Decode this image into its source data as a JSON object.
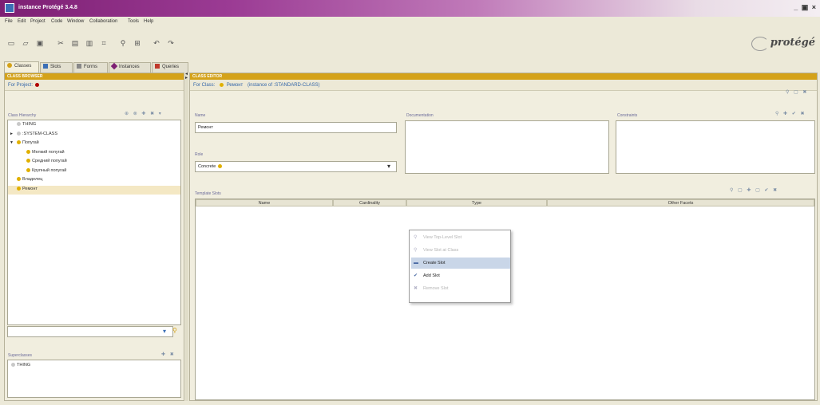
{
  "window": {
    "title": "instance  Protégé 3.4.8",
    "controls": "_ ▣ ×"
  },
  "menu": [
    "File",
    "Edit",
    "Project",
    "Code",
    "Window",
    "Collaboration",
    "Tools",
    "Help"
  ],
  "logo": {
    "text": "protégé"
  },
  "tabs": [
    {
      "label": "Classes",
      "active": true,
      "icon_color": "#d4a219"
    },
    {
      "label": "Slots",
      "active": false,
      "icon_color": "#3b6fb6"
    },
    {
      "label": "Forms",
      "active": false,
      "icon_color": "#888888"
    },
    {
      "label": "Instances",
      "active": false,
      "icon_color": "#7d1f73"
    },
    {
      "label": "Queries",
      "active": false,
      "icon_color": "#c0392b"
    }
  ],
  "left_panel": {
    "browser_header": "CLASS BROWSER",
    "for_project_label": "For Project:",
    "hierarchy_label": "Class Hierarchy",
    "tree": [
      {
        "label": "THING",
        "level": 0,
        "expander": "",
        "selected": false,
        "dot_color": "#c8c8c8"
      },
      {
        "label": ":SYSTEM-CLASS",
        "level": 0,
        "expander": "►",
        "selected": false,
        "dot_color": "#c8c8c8"
      },
      {
        "label": "Попугай",
        "level": 0,
        "expander": "▼",
        "selected": false,
        "dot_color": "#e0b000"
      },
      {
        "label": "Мелкий попугай",
        "level": 1,
        "expander": "",
        "selected": false,
        "dot_color": "#e0b000"
      },
      {
        "label": "Средний попугай",
        "level": 1,
        "expander": "",
        "selected": false,
        "dot_color": "#e0b000"
      },
      {
        "label": "Крупный попугай",
        "level": 1,
        "expander": "",
        "selected": false,
        "dot_color": "#e0b000"
      },
      {
        "label": "Владелец",
        "level": 0,
        "expander": "",
        "selected": false,
        "dot_color": "#e0b000"
      },
      {
        "label": "Ремонт",
        "level": 0,
        "expander": "",
        "selected": true,
        "dot_color": "#e0b000"
      }
    ],
    "superclasses_label": "Superclasses",
    "superclasses": [
      "THING"
    ]
  },
  "right_panel": {
    "editor_header": "CLASS EDITOR",
    "for_class_label": "For Class:",
    "for_class_name": "Ремонт",
    "for_class_meta": "(instance of :STANDARD-CLASS)",
    "name_label": "Name",
    "name_value": "Ремонт",
    "role_label": "Role",
    "role_value": "Concrete",
    "documentation_label": "Documentation",
    "constraints_label": "Constraints",
    "template_slots_label": "Template Slots",
    "columns": [
      "Name",
      "Cardinality",
      "Type",
      "Other Facets"
    ]
  },
  "context_menu": {
    "items": [
      {
        "label": "View Top-Level Slot",
        "enabled": false,
        "highlighted": false,
        "icon": "view-icon"
      },
      {
        "label": "View Slot at Class",
        "enabled": false,
        "highlighted": false,
        "icon": "view-icon"
      },
      {
        "label": "Create Slot",
        "enabled": true,
        "highlighted": true,
        "icon": "create-slot-icon"
      },
      {
        "label": "Add Slot",
        "enabled": true,
        "highlighted": false,
        "icon": "add-slot-icon"
      },
      {
        "label": "Remove Slot",
        "enabled": false,
        "highlighted": false,
        "icon": "remove-slot-icon"
      }
    ]
  }
}
